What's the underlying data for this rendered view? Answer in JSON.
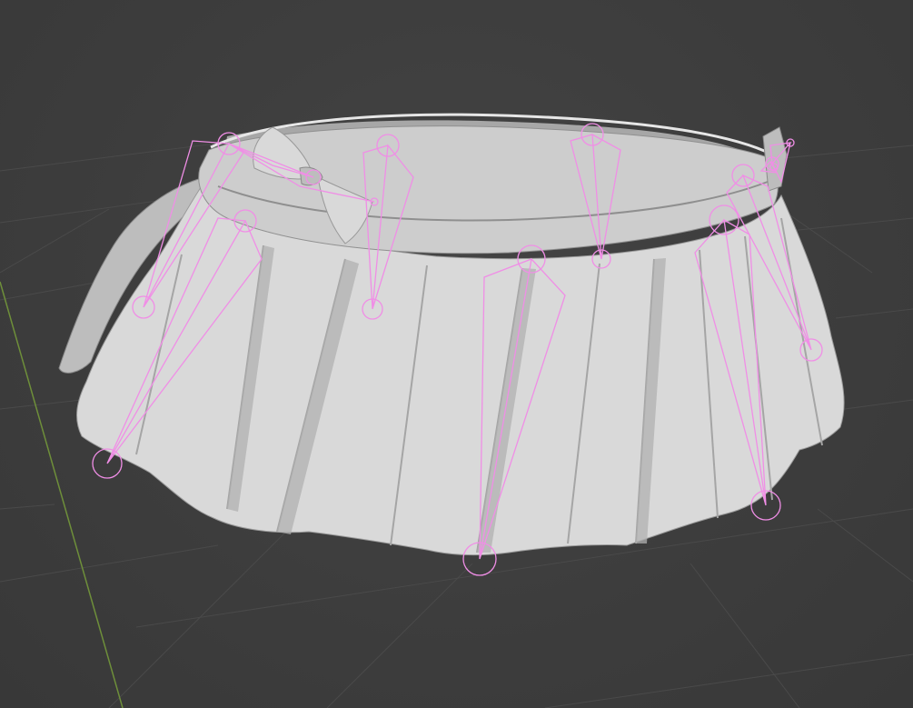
{
  "viewport": {
    "editor": "3d-viewport",
    "shading": "solid",
    "overlays": {
      "floor_grid": true,
      "y_axis_line": true,
      "armature_display": "stick"
    }
  },
  "colors": {
    "background": "#3d3d3d",
    "grid_line": "#4a4a4a",
    "axis_y": "#6e8f3a",
    "mesh_light": "#d9d9d9",
    "mesh_mid": "#bdbdbd",
    "mesh_dark": "#8e8e8e",
    "mesh_inner": "#a7a7a7",
    "bone_wire": "#f08ee6"
  },
  "scene": {
    "object_mesh": "pleated-skirt-with-bow",
    "armature_chain_count": 10
  }
}
